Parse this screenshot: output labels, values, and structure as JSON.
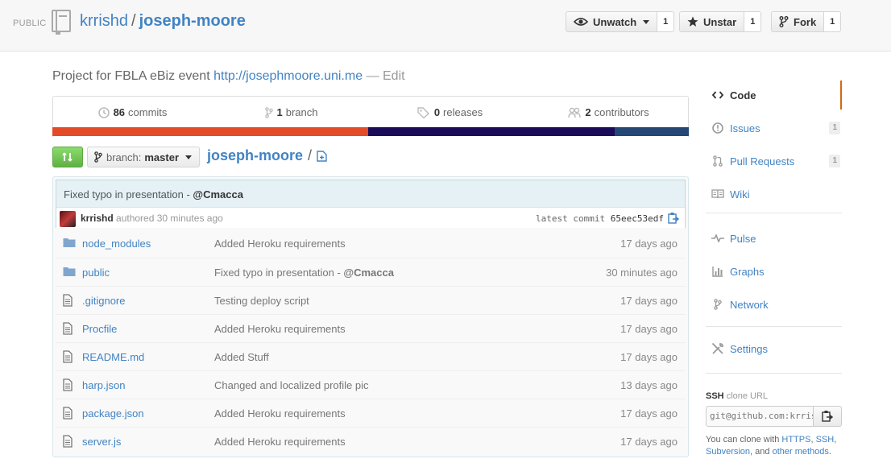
{
  "header": {
    "visibility": "PUBLIC",
    "owner": "krrishd",
    "separator": "/",
    "repo": "joseph-moore",
    "unwatch": {
      "label": "Unwatch",
      "count": "1"
    },
    "unstar": {
      "label": "Unstar",
      "count": "1"
    },
    "fork": {
      "label": "Fork",
      "count": "1"
    }
  },
  "description": {
    "text": "Project for FBLA eBiz event",
    "url": "http://josephmoore.uni.me",
    "edit": "— Edit"
  },
  "summary": {
    "commits": {
      "count": "86",
      "label": "commits"
    },
    "branch": {
      "count": "1",
      "label": "branch"
    },
    "releases": {
      "count": "0",
      "label": "releases"
    },
    "contributors": {
      "count": "2",
      "label": "contributors"
    }
  },
  "languages": [
    {
      "color": "#e34c26",
      "share": 0.496
    },
    {
      "color": "#1b0c5a",
      "share": 0.388
    },
    {
      "color": "#244776",
      "share": 0.116
    }
  ],
  "file_nav": {
    "branch_prefix": "branch:",
    "branch_name": "master",
    "root": "joseph-moore",
    "slash": "/"
  },
  "commit": {
    "message": "Fixed typo in presentation - ",
    "mention": "@Cmacca",
    "author": "krrishd",
    "authored": "authored 30 minutes ago",
    "latest_label": "latest commit",
    "sha": "65eec53edf"
  },
  "files": [
    {
      "type": "dir",
      "name": "node_modules",
      "message": "Added Heroku requirements",
      "mention": "",
      "age": "17 days ago"
    },
    {
      "type": "dir",
      "name": "public",
      "message": "Fixed typo in presentation - ",
      "mention": "@Cmacca",
      "age": "30 minutes ago"
    },
    {
      "type": "file",
      "name": ".gitignore",
      "message": "Testing deploy script",
      "mention": "",
      "age": "17 days ago"
    },
    {
      "type": "file",
      "name": "Procfile",
      "message": "Added Heroku requirements",
      "mention": "",
      "age": "17 days ago"
    },
    {
      "type": "file",
      "name": "README.md",
      "message": "Added Stuff",
      "mention": "",
      "age": "17 days ago"
    },
    {
      "type": "file",
      "name": "harp.json",
      "message": "Changed and localized profile pic",
      "mention": "",
      "age": "13 days ago"
    },
    {
      "type": "file",
      "name": "package.json",
      "message": "Added Heroku requirements",
      "mention": "",
      "age": "17 days ago"
    },
    {
      "type": "file",
      "name": "server.js",
      "message": "Added Heroku requirements",
      "mention": "",
      "age": "17 days ago"
    }
  ],
  "sidebar": {
    "code": "Code",
    "issues": {
      "label": "Issues",
      "count": "1"
    },
    "pulls": {
      "label": "Pull Requests",
      "count": "1"
    },
    "wiki": "Wiki",
    "pulse": "Pulse",
    "graphs": "Graphs",
    "network": "Network",
    "settings": "Settings"
  },
  "clone": {
    "protocol": "SSH",
    "label_suffix": "clone URL",
    "url": "git@github.com:krrishd/joseph-moore.git",
    "help_prefix": "You can clone with",
    "https": "HTTPS",
    "ssh": "SSH",
    "subversion": "Subversion",
    "help_and": ", and",
    "other": "other methods",
    "period": "."
  },
  "colors": {
    "link": "#4183c4",
    "selected_nav": "#d26911",
    "compare_green": "#60b044"
  }
}
